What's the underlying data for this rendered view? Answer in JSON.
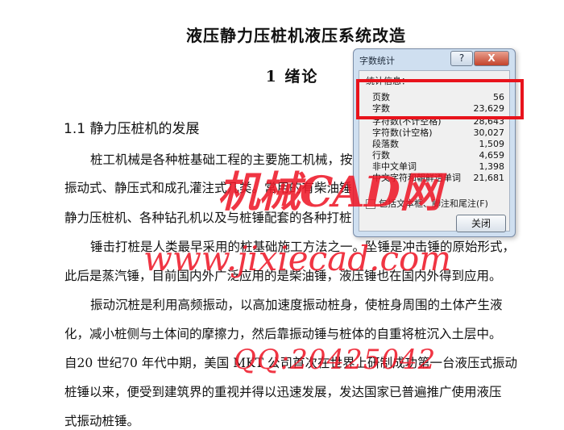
{
  "document": {
    "title": "液压静力压桩机液压系统改造",
    "chapter": "1   绪论",
    "section": "1.1 静力压桩机的发展",
    "lines": [
      "桩工机械是各种桩基础工程的主要施工机械，按",
      "振动式、静压式和成孔灌注式几类。常用的有柴油锤",
      "静力压桩机、各种钻孔机以及与桩锤配套的各种打桩",
      "锤击打桩是人类最早采用的桩基础施工方法之一。坠锤是冲击锤的原始形式，",
      "此后是蒸汽锤，目前国内外广泛应用的是柴油锤，液压锤也在国内外得到应用。",
      "振动沉桩是利用高频振动，以高加速度振动桩身，使桩身周围的土体产生液",
      "化，减小桩侧与土体间的摩擦力，然后靠振动锤与桩体的自重将桩沉入土层中。",
      "自20 世纪70 年代中期，美国 MKT 公司首次在世界上研制成功第一台液压式振动",
      "桩锤以来，便受到建筑界的重视并得以迅速发展，发达国家已普遍推广使用液压",
      "式振动桩锤。"
    ]
  },
  "dialog": {
    "title": "字数统计",
    "help_label": "?",
    "close_label": "X",
    "stats_label": "统计信息：",
    "stats": [
      {
        "key": "页数",
        "value": "56"
      },
      {
        "key": "字数",
        "value": "23,629"
      },
      {
        "key": "字符数(不计空格)",
        "value": "28,643"
      },
      {
        "key": "字符数(计空格)",
        "value": "30,027"
      },
      {
        "key": "段落数",
        "value": "1,509"
      },
      {
        "key": "行数",
        "value": "4,659"
      },
      {
        "key": "非中文单词",
        "value": "1,398"
      },
      {
        "key": "中文字符和朝鲜语单词",
        "value": "21,681"
      }
    ],
    "checkbox_label": "包括文本框、脚注和尾注(F)",
    "checkbox_checked": false,
    "ok_label": "关闭"
  },
  "watermark": {
    "line1": "机械CAD网",
    "line2": "www.jixiecad.com",
    "line3": "QQ:20425042"
  }
}
